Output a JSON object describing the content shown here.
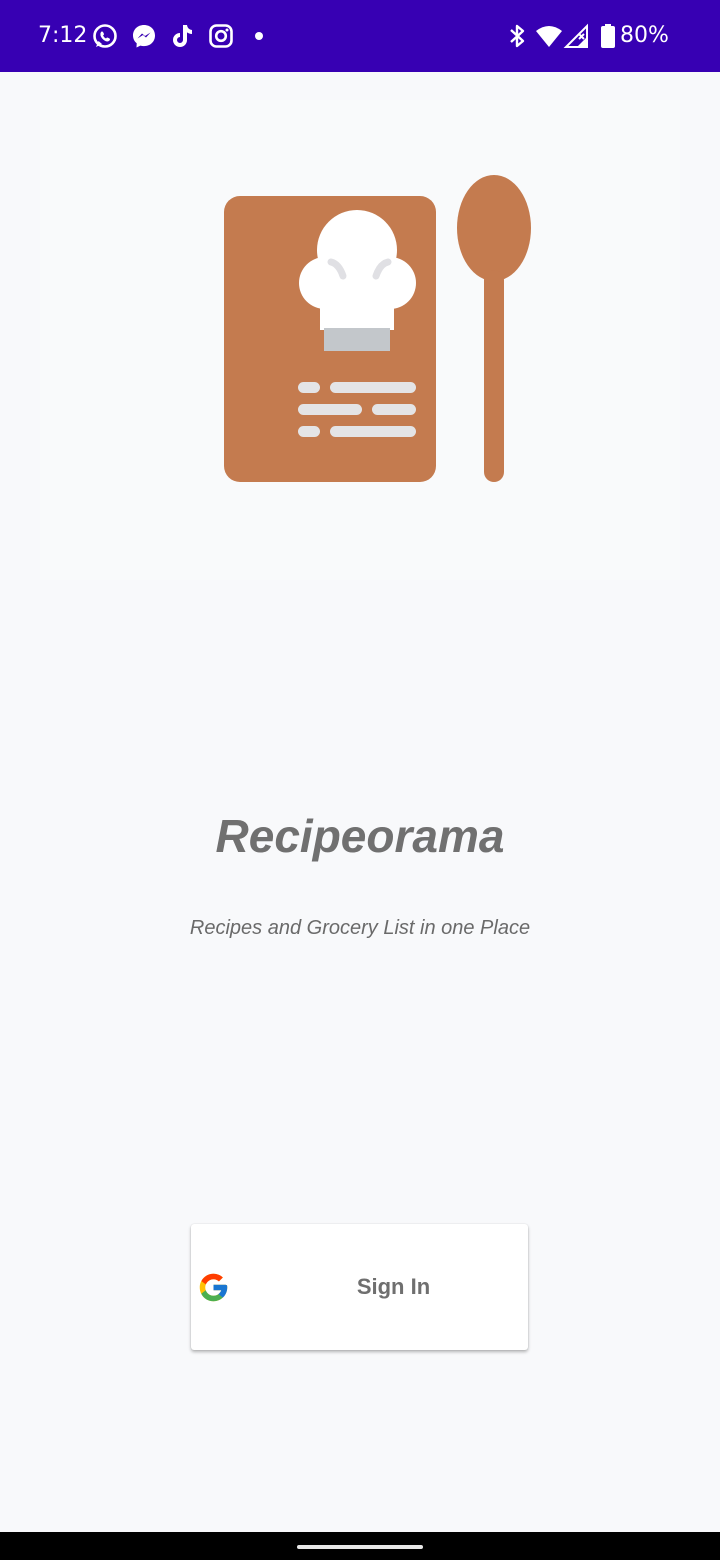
{
  "status_bar": {
    "time": "7:12",
    "battery_percent": "80%",
    "notification_icons": [
      "whatsapp-icon",
      "messenger-icon",
      "tiktok-icon",
      "instagram-icon"
    ],
    "system_icons": [
      "bluetooth-icon",
      "wifi-icon",
      "cellular-signal-icon",
      "battery-icon"
    ],
    "background_color": "#3700b3"
  },
  "logo": {
    "icon": "recipe-book-with-spoon-icon",
    "accent_color": "#c47b4f"
  },
  "app": {
    "title": "Recipeorama",
    "subtitle": "Recipes and Grocery List in one Place"
  },
  "sign_in": {
    "label": "Sign In",
    "icon": "google-icon"
  },
  "nav_bar": {
    "indicator": "home-indicator"
  }
}
